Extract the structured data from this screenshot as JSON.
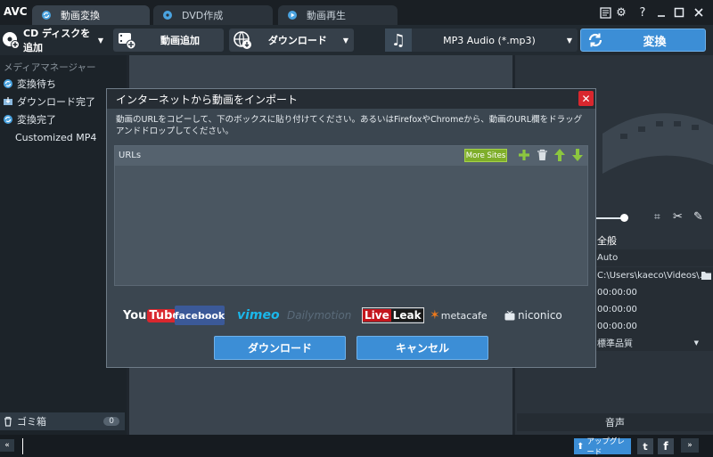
{
  "app": {
    "name": "AVC"
  },
  "tabs": [
    {
      "label": "動画変換",
      "icon": "refresh-icon"
    },
    {
      "label": "DVD作成",
      "icon": "disc-icon"
    },
    {
      "label": "動画再生",
      "icon": "play-icon"
    }
  ],
  "toolbar": {
    "add_cd": "CD ディスクを追加",
    "add_video": "動画追加",
    "download": "ダウンロード",
    "format": "MP3 Audio (*.mp3)",
    "convert": "変換"
  },
  "sidebar": {
    "heading": "メディアマネージャー",
    "items": [
      {
        "label": "変換待ち",
        "icon": "refresh-icon"
      },
      {
        "label": "ダウンロード完了",
        "icon": "download-icon"
      },
      {
        "label": "変換完了",
        "icon": "refresh-icon"
      },
      {
        "label": "Customized MP4",
        "icon": ""
      }
    ],
    "trash_label": "ゴミ箱",
    "trash_count": "0"
  },
  "right_panel": {
    "tab_general": "全般",
    "rows": [
      "Auto",
      "C:\\Users\\kaeco\\Videos\\...",
      "00:00:00",
      "00:00:00",
      "00:00:00",
      "標準品質"
    ],
    "audio_label": "音声"
  },
  "dialog": {
    "title": "インターネットから動画をインポート",
    "description": "動画のURLをコピーして、下のボックスに貼り付けてください。あるいはFirefoxやChromeから、動画のURL欄をドラッグアンドドロップしてください。",
    "urls_label": "URLs",
    "more_sites": "More Sites",
    "download_button": "ダウンロード",
    "cancel_button": "キャンセル",
    "sites": [
      "YouTube",
      "facebook",
      "vimeo",
      "Dailymotion",
      "LiveLeak",
      "metacafe",
      "niconico"
    ]
  },
  "statusbar": {
    "upgrade": "アップグレード"
  }
}
